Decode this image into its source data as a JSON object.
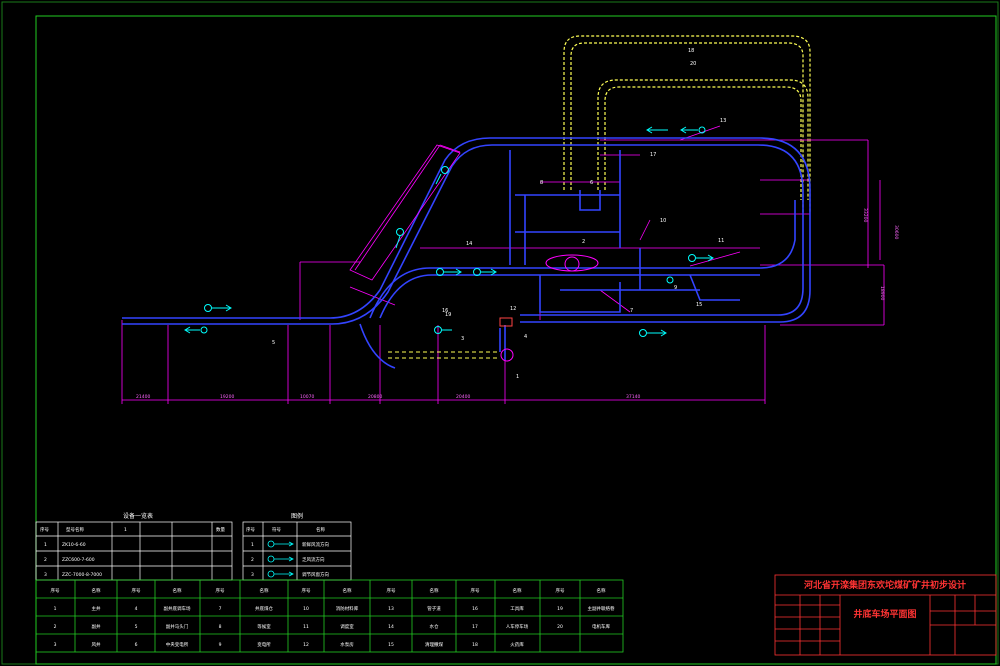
{
  "title_block": {
    "project": "河北省开滦集团东欢坨煤矿矿井初步设计",
    "drawing": "井底车场平面图"
  },
  "equipment_table": {
    "title": "设备一览表",
    "header": [
      "序号",
      "型号名称",
      "1",
      "",
      "",
      "数量"
    ],
    "rows": [
      [
        "1",
        "ZK10-6-60",
        "",
        "",
        "",
        ""
      ],
      [
        "2",
        "ZZC600-7-600",
        "",
        "",
        "",
        ""
      ],
      [
        "3",
        "ZZC-7000-8-7000",
        "",
        "",
        "",
        ""
      ]
    ]
  },
  "legend": {
    "title": "图例",
    "header": [
      "序号",
      "符号",
      "名称"
    ],
    "rows": [
      [
        "1",
        "",
        "新鲜风流方向"
      ],
      [
        "2",
        "",
        "乏风流方向"
      ],
      [
        "3",
        "",
        "调节风窗方向"
      ]
    ]
  },
  "chamber_table": {
    "header": [
      "序号",
      "名称",
      "序号",
      "名称",
      "序号",
      "名称",
      "序号",
      "名称",
      "序号",
      "名称",
      "序号",
      "名称",
      "序号",
      "名称"
    ],
    "rows": [
      [
        "1",
        "主井",
        "4",
        "副井底调车场",
        "7",
        "井底煤仓",
        "10",
        "消防材料库",
        "13",
        "管子道",
        "16",
        "工具库",
        "19",
        "主副井联络巷"
      ],
      [
        "2",
        "副井",
        "5",
        "副井马头门",
        "8",
        "等候室",
        "11",
        "调度室",
        "14",
        "水仓",
        "17",
        "人车停车场",
        "20",
        "电机车库"
      ],
      [
        "3",
        "风井",
        "6",
        "中央变电所",
        "9",
        "变电所",
        "12",
        "水泵房",
        "15",
        "清理撒煤",
        "18",
        "火药库",
        "",
        ""
      ]
    ]
  },
  "labels": [
    "1",
    "2",
    "3",
    "4",
    "5",
    "6",
    "7",
    "8",
    "9",
    "10",
    "11",
    "12",
    "13",
    "14",
    "15",
    "16",
    "17",
    "18",
    "19",
    "20"
  ],
  "dimensions": [
    "21400",
    "19200",
    "10070",
    "20800",
    "20400",
    "37140",
    "33200",
    "30600",
    "18900"
  ],
  "colors": {
    "background": "#000000",
    "frame": "#22cc22",
    "tunnel": "#3344ff",
    "dimension": "#ff00ff",
    "rail": "#ffff55",
    "annotation": "#00ffff",
    "title_text": "#ff3333",
    "table_text": "#ffffff"
  }
}
